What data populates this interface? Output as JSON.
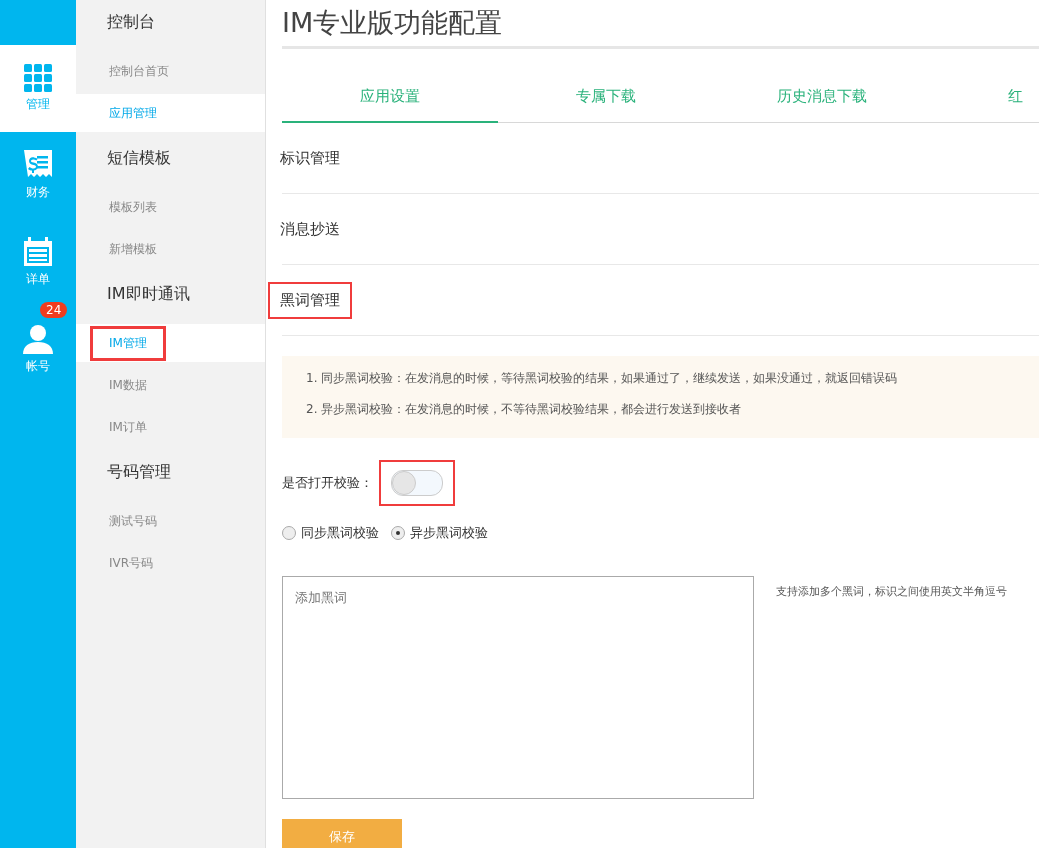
{
  "rail": [
    {
      "label": "管理",
      "kind": "grid",
      "selected": true
    },
    {
      "label": "财务",
      "kind": "receipt",
      "selected": false
    },
    {
      "label": "详单",
      "kind": "calendar",
      "selected": false
    },
    {
      "label": "帐号",
      "kind": "user",
      "selected": false,
      "badge": "24"
    }
  ],
  "subnav": [
    {
      "title": "控制台",
      "items": [
        {
          "label": "控制台首页",
          "selected": false,
          "highlighted": false
        },
        {
          "label": "应用管理",
          "selected": true,
          "highlighted": false
        }
      ]
    },
    {
      "title": "短信模板",
      "items": [
        {
          "label": "模板列表",
          "selected": false,
          "highlighted": false
        },
        {
          "label": "新增模板",
          "selected": false,
          "highlighted": false
        }
      ]
    },
    {
      "title": "IM即时通讯",
      "items": [
        {
          "label": "IM管理",
          "selected": true,
          "highlighted": true
        },
        {
          "label": "IM数据",
          "selected": false,
          "highlighted": false
        },
        {
          "label": "IM订单",
          "selected": false,
          "highlighted": false
        }
      ]
    },
    {
      "title": "号码管理",
      "items": [
        {
          "label": "测试号码",
          "selected": false,
          "highlighted": false
        },
        {
          "label": "IVR号码",
          "selected": false,
          "highlighted": false
        }
      ]
    }
  ],
  "page_title": "IM专业版功能配置",
  "tabs": [
    {
      "label": "应用设置",
      "selected": true
    },
    {
      "label": "专属下载",
      "selected": false
    },
    {
      "label": "历史消息下载",
      "selected": false
    },
    {
      "label": "红",
      "selected": false
    }
  ],
  "sections": [
    {
      "label": "标识管理",
      "highlighted": false
    },
    {
      "label": "消息抄送",
      "highlighted": false
    },
    {
      "label": "黑词管理",
      "highlighted": true
    }
  ],
  "notice": [
    "1. 同步黑词校验：在发消息的时候，等待黑词校验的结果，如果通过了，继续发送，如果没通过，就返回错误码",
    "2. 异步黑词校验：在发消息的时候，不等待黑词校验结果，都会进行发送到接收者"
  ],
  "toggle": {
    "label": "是否打开校验：",
    "on": false,
    "highlighted": true
  },
  "radios": [
    {
      "label": "同步黑词校验",
      "selected": false
    },
    {
      "label": "异步黑词校验",
      "selected": true
    }
  ],
  "blackwords": {
    "placeholder": "添加黑词",
    "hint": "支持添加多个黑词，标识之间使用英文半角逗号"
  },
  "save_button": "保存"
}
